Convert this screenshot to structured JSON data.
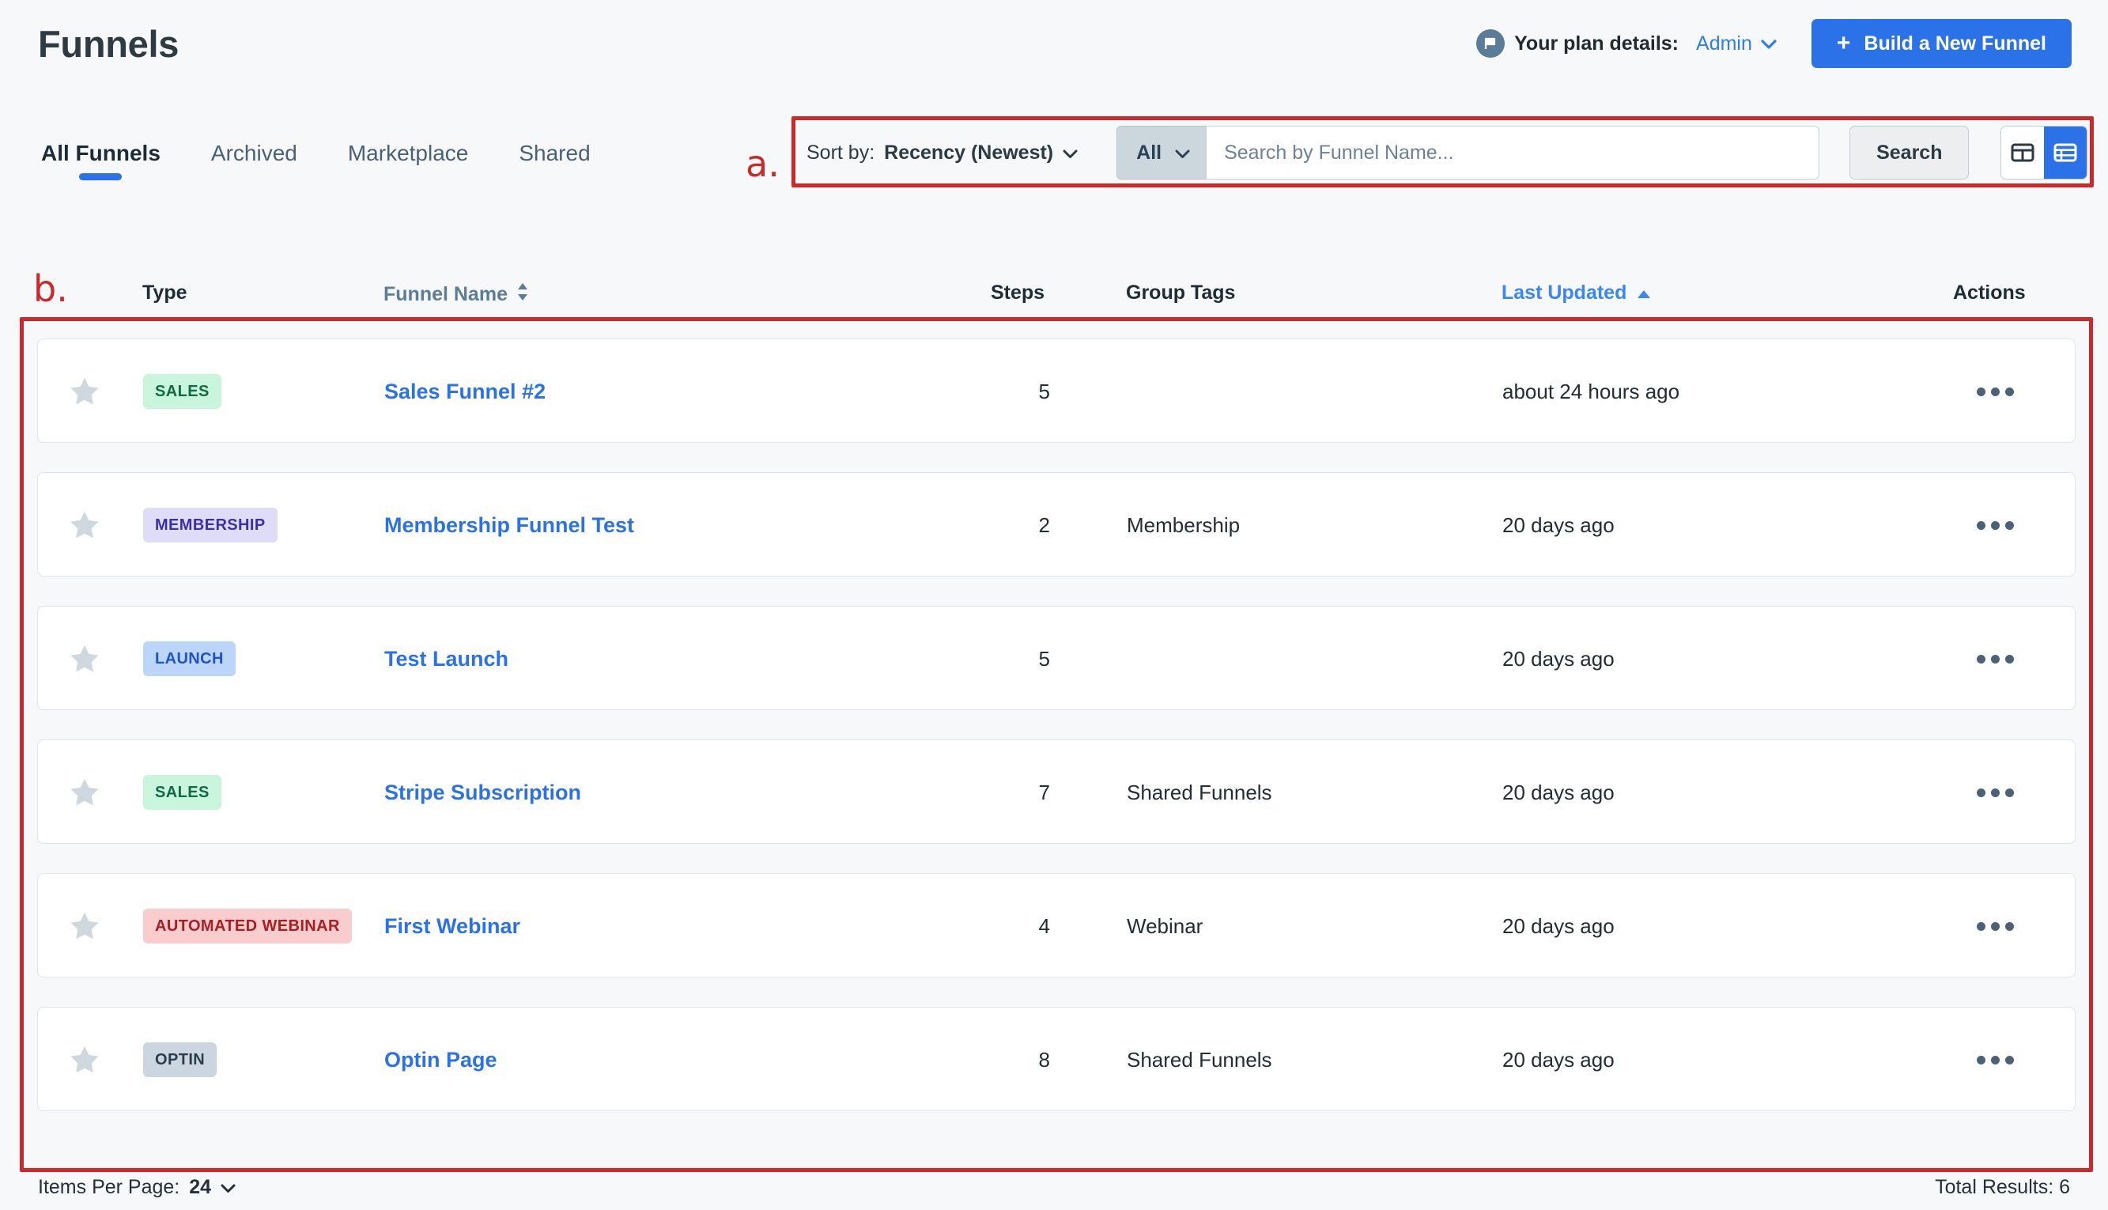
{
  "header": {
    "title": "Funnels",
    "plan_label": "Your plan details:",
    "plan_value": "Admin",
    "plan_chevron": "⌄",
    "build_plus": "+",
    "build_label": "Build a New Funnel",
    "flag_icon": "flag-icon"
  },
  "tabs": [
    {
      "label": "All Funnels",
      "active": true
    },
    {
      "label": "Archived",
      "active": false
    },
    {
      "label": "Marketplace",
      "active": false
    },
    {
      "label": "Shared",
      "active": false
    }
  ],
  "annotations": {
    "a": "a.",
    "b": "b."
  },
  "toolbar": {
    "sort_prefix": "Sort by:",
    "sort_value": "Recency (Newest)",
    "sort_chevron": "⌄",
    "filter_value": "All",
    "filter_chevron": "⌄",
    "search_placeholder": "Search by Funnel Name...",
    "search_value": "",
    "search_label": "Search",
    "view_card_icon": "card-view-icon",
    "view_list_icon": "list-view-icon"
  },
  "table": {
    "columns": {
      "type": "Type",
      "name": "Funnel Name",
      "name_sort_icon": "⬍",
      "steps": "Steps",
      "tags": "Group Tags",
      "updated": "Last Updated",
      "updated_sort_icon": "▲",
      "actions": "Actions"
    },
    "rows": [
      {
        "favorite_icon": "star-icon",
        "type": "SALES",
        "type_bg": "#c8f5dc",
        "type_fg": "#0f6b43",
        "name": "Sales Funnel #2",
        "steps": "5",
        "tags": "",
        "updated": "about 24 hours ago",
        "actions_icon": "more-options-icon"
      },
      {
        "favorite_icon": "star-icon",
        "type": "MEMBERSHIP",
        "type_bg": "#dedcf7",
        "type_fg": "#3b2fa8",
        "name": "Membership Funnel Test",
        "steps": "2",
        "tags": "Membership",
        "updated": "20 days ago",
        "actions_icon": "more-options-icon"
      },
      {
        "favorite_icon": "star-icon",
        "type": "LAUNCH",
        "type_bg": "#bcd5fb",
        "type_fg": "#1f54c4",
        "name": "Test Launch",
        "steps": "5",
        "tags": "",
        "updated": "20 days ago",
        "actions_icon": "more-options-icon"
      },
      {
        "favorite_icon": "star-icon",
        "type": "SALES",
        "type_bg": "#c8f5dc",
        "type_fg": "#0f6b43",
        "name": "Stripe Subscription",
        "steps": "7",
        "tags": "Shared Funnels",
        "updated": "20 days ago",
        "actions_icon": "more-options-icon"
      },
      {
        "favorite_icon": "star-icon",
        "type": "AUTOMATED WEBINAR",
        "type_bg": "#f9cccd",
        "type_fg": "#a81f22",
        "name": "First Webinar",
        "steps": "4",
        "tags": "Webinar",
        "updated": "20 days ago",
        "actions_icon": "more-options-icon"
      },
      {
        "favorite_icon": "star-icon",
        "type": "OPTIN",
        "type_bg": "#ccd6e0",
        "type_fg": "#2a3d4d",
        "name": "Optin Page",
        "steps": "8",
        "tags": "Shared Funnels",
        "updated": "20 days ago",
        "actions_icon": "more-options-icon"
      }
    ]
  },
  "footer": {
    "items_per_page_label": "Items Per Page:",
    "items_per_page_value": "24",
    "items_per_page_chevron": "⌄",
    "total_results": "Total Results: 6"
  },
  "colors": {
    "accent_blue": "#2b72e8",
    "annotation_red": "#cc2a2a",
    "page_bg": "#f6f8fa",
    "link_blue": "#2b72e8",
    "sort_active_blue": "#3b86f0"
  }
}
